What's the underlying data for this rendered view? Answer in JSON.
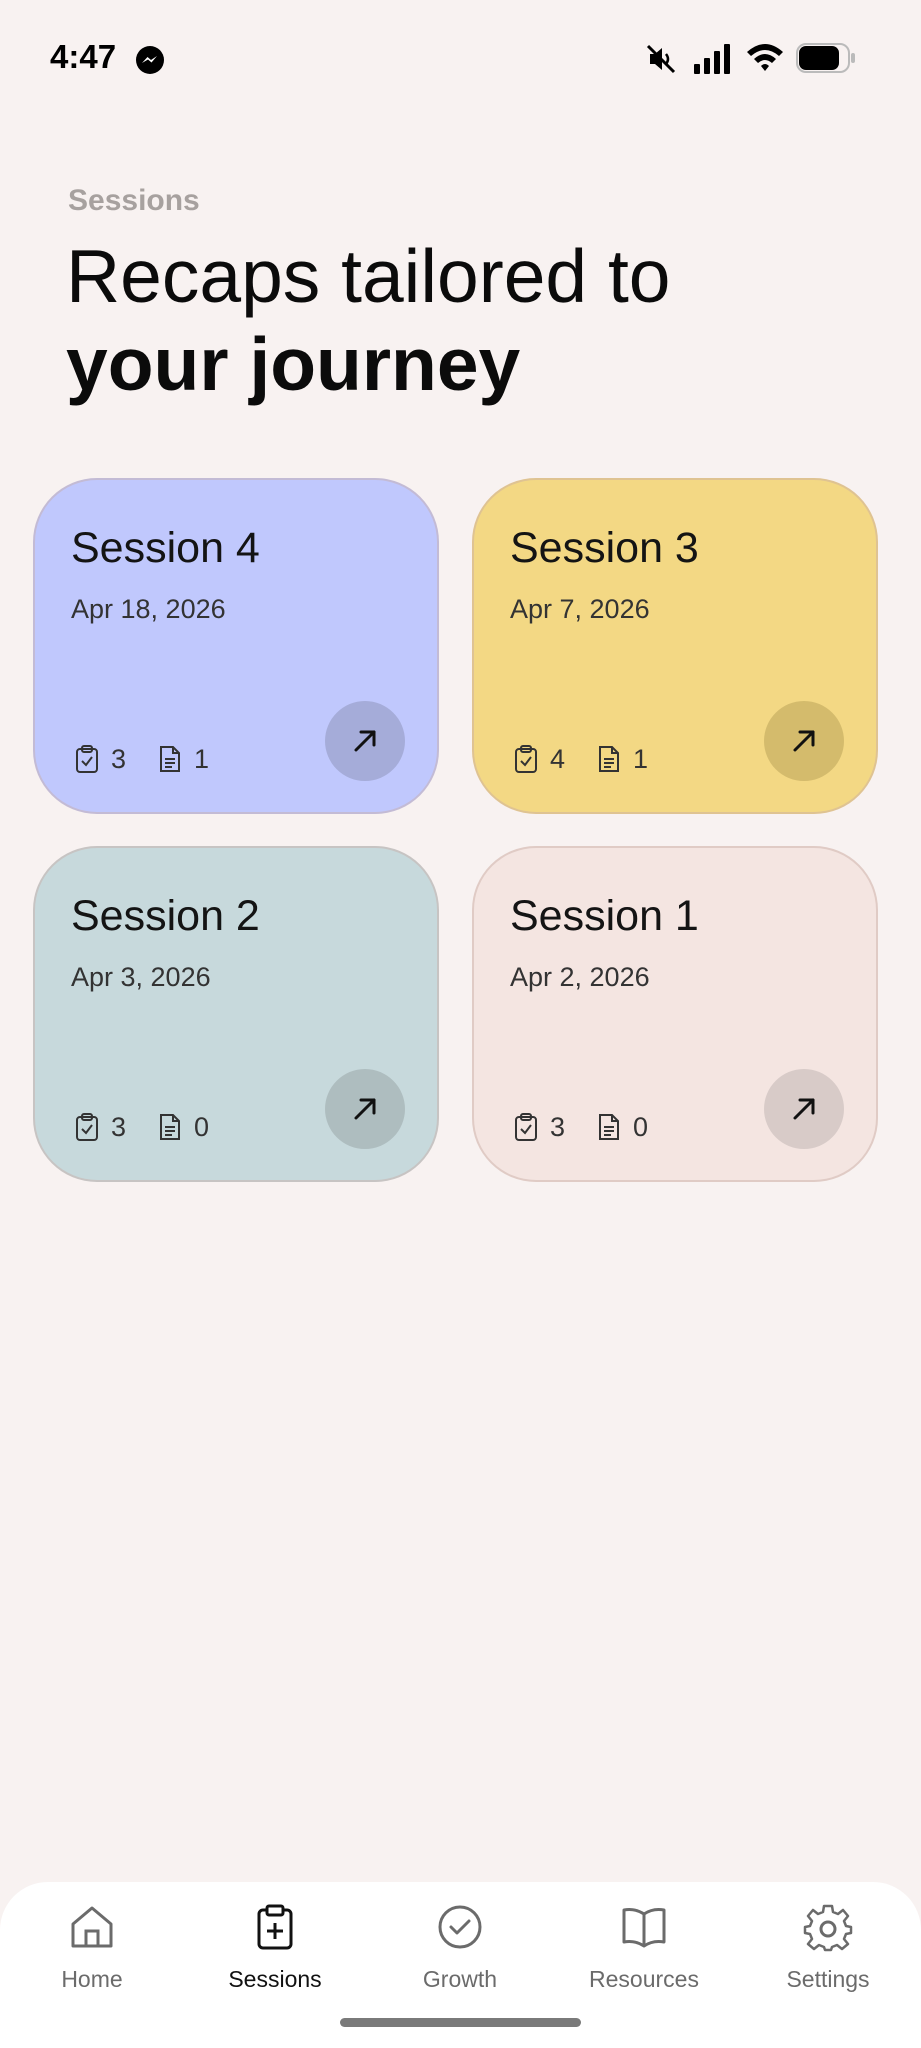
{
  "status_bar": {
    "time": "4:47"
  },
  "header": {
    "eyebrow": "Sessions",
    "headline_line1": "Recaps tailored to",
    "headline_line2": "your journey"
  },
  "sessions": [
    {
      "title": "Session 4",
      "date": "Apr 18, 2026",
      "tasks": "3",
      "notes": "1",
      "color": "#c0c8fd",
      "button_color": "#a5acd9"
    },
    {
      "title": "Session 3",
      "date": "Apr 7, 2026",
      "tasks": "4",
      "notes": "1",
      "color": "#f3d884",
      "button_color": "#d4bb6c"
    },
    {
      "title": "Session 2",
      "date": "Apr 3, 2026",
      "tasks": "3",
      "notes": "0",
      "color": "#c7d9dc",
      "button_color": "#aebdbf"
    },
    {
      "title": "Session 1",
      "date": "Apr 2, 2026",
      "tasks": "3",
      "notes": "0",
      "color": "#f4e5e1",
      "button_color": "#d8cbc8"
    }
  ],
  "tab_bar": {
    "active": "Sessions",
    "tabs": [
      {
        "label": "Home",
        "icon": "home-icon"
      },
      {
        "label": "Sessions",
        "icon": "clipboard-plus-icon"
      },
      {
        "label": "Growth",
        "icon": "check-circle-icon"
      },
      {
        "label": "Resources",
        "icon": "book-icon"
      },
      {
        "label": "Settings",
        "icon": "gear-icon"
      }
    ]
  }
}
